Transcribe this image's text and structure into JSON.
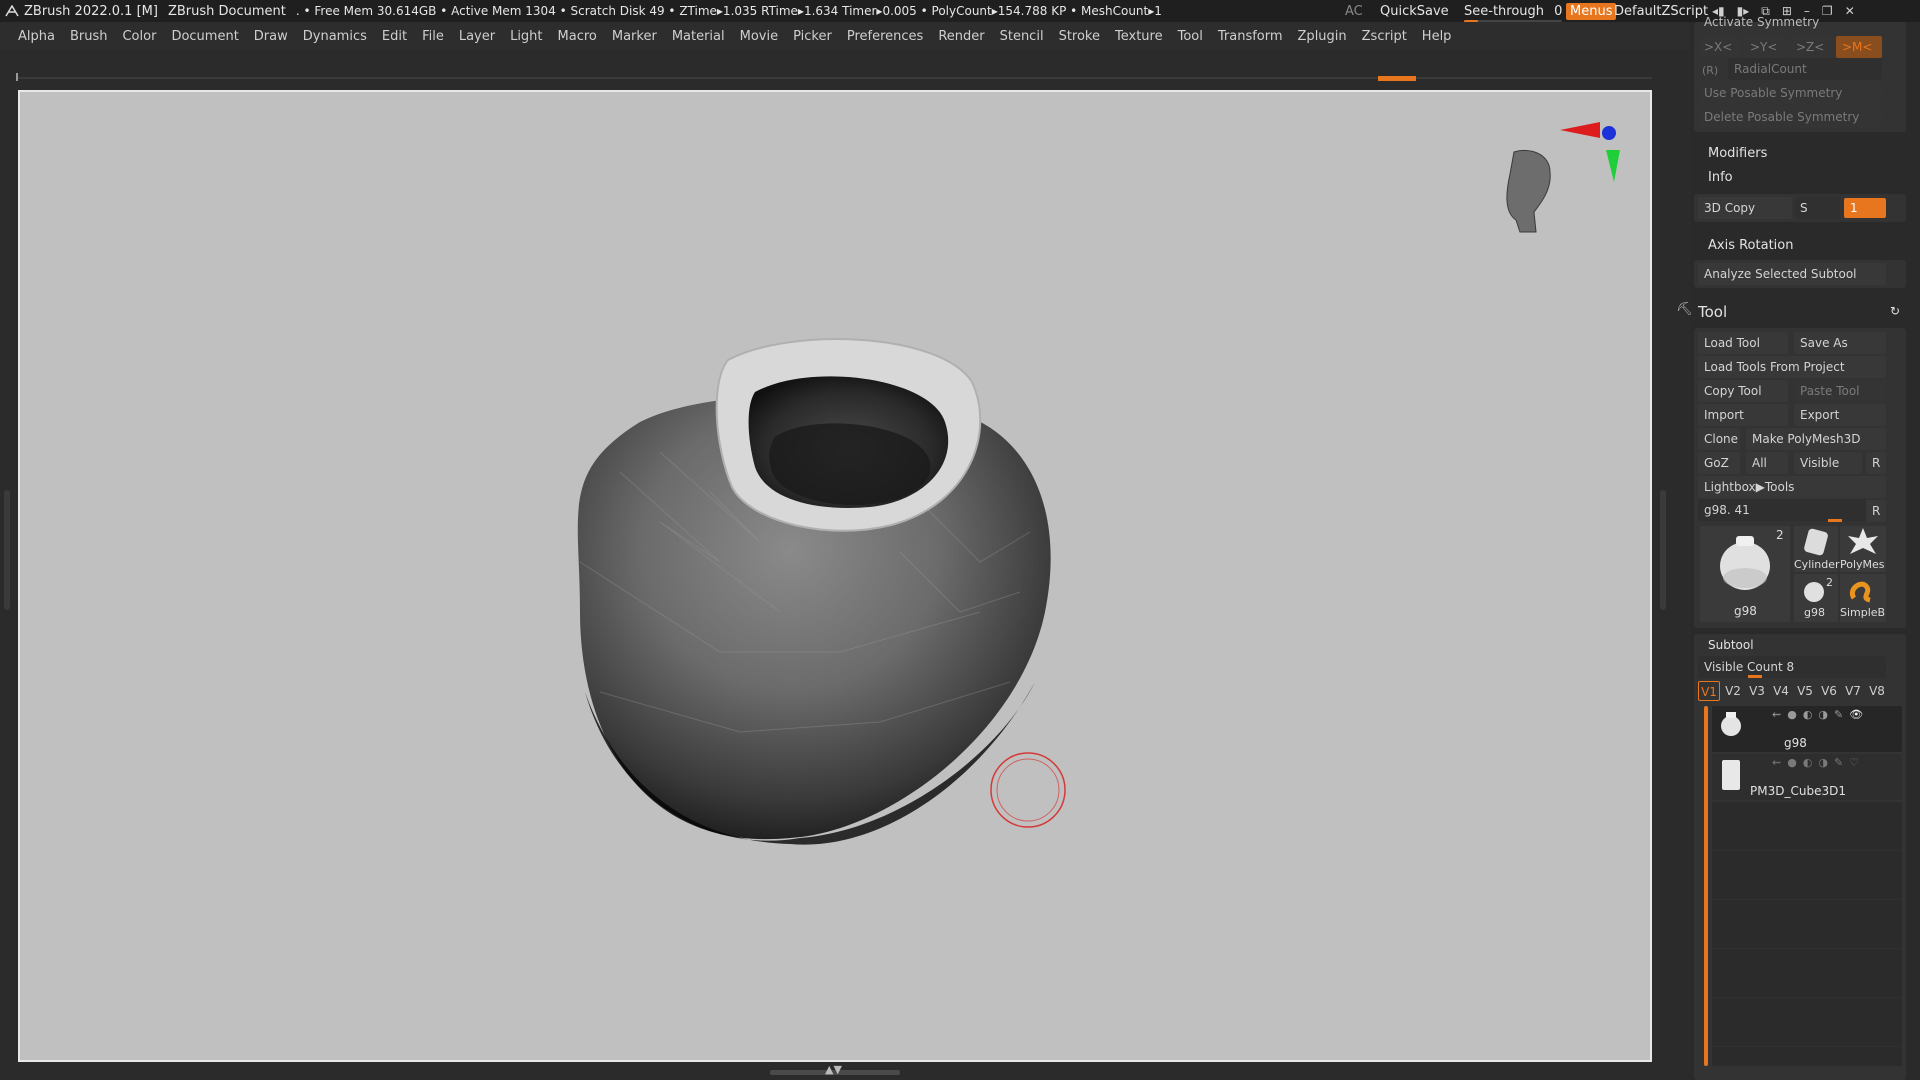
{
  "titlebar": {
    "app": "ZBrush 2022.0.1 [M]",
    "document": "ZBrush Document",
    "stats": ". • Free Mem 30.614GB • Active Mem 1304 • Scratch Disk 49 •  ZTime▸1.035 RTime▸1.634 Timer▸0.005 • PolyCount▸154.788 KP  • MeshCount▸1",
    "ac": "AC",
    "quicksave": "QuickSave",
    "see_through_label": "See-through",
    "see_through_value": "0",
    "menus": "Menus",
    "default_zscript": "DefaultZScript"
  },
  "menubar": [
    "Alpha",
    "Brush",
    "Color",
    "Document",
    "Draw",
    "Dynamics",
    "Edit",
    "File",
    "Layer",
    "Light",
    "Macro",
    "Marker",
    "Material",
    "Movie",
    "Picker",
    "Preferences",
    "Render",
    "Stencil",
    "Stroke",
    "Texture",
    "Tool",
    "Transform",
    "Zplugin",
    "Zscript",
    "Help"
  ],
  "panel": {
    "activate_symmetry": "Activate Symmetry",
    "sym_x": ">X<",
    "sym_y": ">Y<",
    "sym_z": ">Z<",
    "sym_m": ">M<",
    "radial_r": "(R)",
    "radial_count": "RadialCount",
    "use_posable": "Use Posable Symmetry",
    "delete_posable": "Delete Posable Symmetry",
    "modifiers": "Modifiers",
    "info": "Info",
    "copy3d": "3D Copy",
    "s_label": "S",
    "s_value": "1",
    "axis_rotation": "Axis Rotation",
    "analyze": "Analyze Selected Subtool",
    "tool_title": "Tool",
    "load_tool": "Load Tool",
    "save_as": "Save As",
    "load_from_project": "Load Tools From Project",
    "copy_tool": "Copy Tool",
    "paste_tool": "Paste Tool",
    "import": "Import",
    "export": "Export",
    "clone": "Clone",
    "make_polymesh": "Make PolyMesh3D",
    "goz": "GoZ",
    "all": "All",
    "visible": "Visible",
    "r": "R",
    "lightbox_tools": "Lightbox▶Tools",
    "current_tool": "g98. 41",
    "thumbs": {
      "main_label": "g98",
      "main_count": "2",
      "cylinder": "Cylinder",
      "polymesh": "PolyMes",
      "small_g98": "g98",
      "small_count": "2",
      "simpleb": "SimpleB"
    },
    "subtool_title": "Subtool",
    "visible_count_label": "Visible Count",
    "visible_count_value": "8",
    "vtabs": [
      "V1",
      "V2",
      "V3",
      "V4",
      "V5",
      "V6",
      "V7",
      "V8"
    ],
    "subtools": [
      {
        "name": "g98"
      },
      {
        "name": "PM3D_Cube3D1"
      }
    ]
  },
  "colors": {
    "accent": "#e8761f",
    "canvas": "#c0c0c0"
  }
}
